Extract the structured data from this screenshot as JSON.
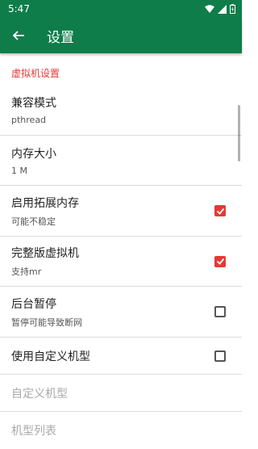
{
  "status_bar": {
    "time": "5:47"
  },
  "app_bar": {
    "title": "设置"
  },
  "section": {
    "header": "虚拟机设置"
  },
  "items": [
    {
      "title": "兼容模式",
      "summary": "pthread"
    },
    {
      "title": "内存大小",
      "summary": "1 M"
    },
    {
      "title": "启用拓展内存",
      "summary": "可能不稳定",
      "checked": true
    },
    {
      "title": "完整版虚拟机",
      "summary": "支持mr",
      "checked": true
    },
    {
      "title": "后台暂停",
      "summary": "暂停可能导致断网",
      "checked": false
    },
    {
      "title": "使用自定义机型",
      "checked": false
    },
    {
      "title": "自定义机型",
      "enabled": false
    },
    {
      "title": "机型列表",
      "enabled": false
    }
  ],
  "colors": {
    "primary": "#0e7d4a",
    "accent": "#e53935"
  }
}
